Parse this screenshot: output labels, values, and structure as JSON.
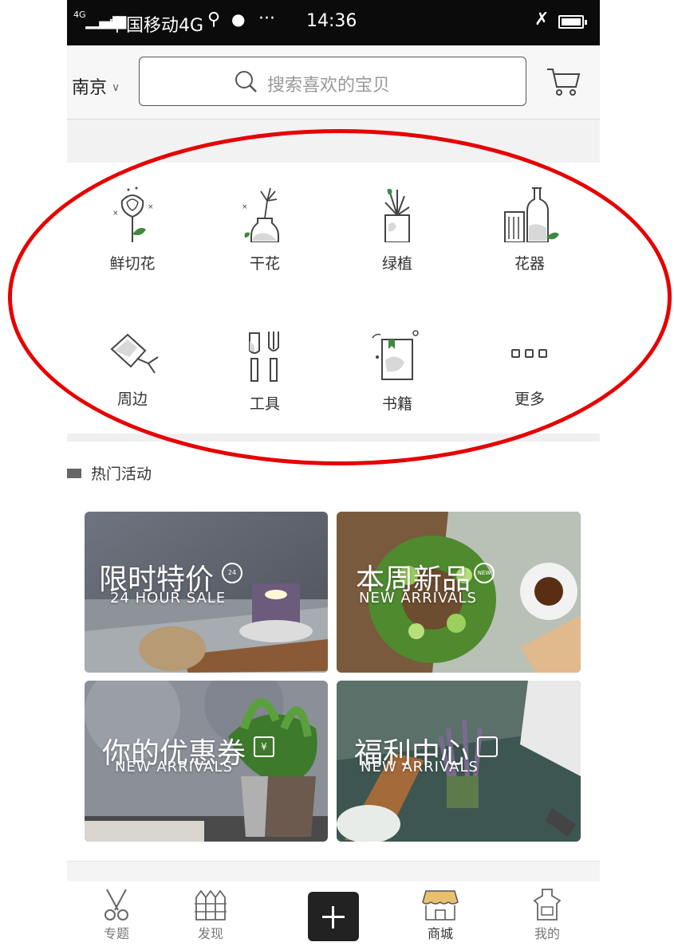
{
  "status_bar": {
    "network": "4G",
    "carrier": "中国移动4G",
    "more": "···",
    "time": "14:36"
  },
  "header": {
    "city": "南京",
    "search_placeholder": "搜索喜欢的宝贝"
  },
  "categories": [
    {
      "label": "鲜切花",
      "icon": "rose-icon"
    },
    {
      "label": "干花",
      "icon": "dried-flower-vase-icon"
    },
    {
      "label": "绿植",
      "icon": "potted-plant-icon"
    },
    {
      "label": "花器",
      "icon": "vases-icon"
    },
    {
      "label": "周边",
      "icon": "watering-can-icon"
    },
    {
      "label": "工具",
      "icon": "trowel-fork-icon"
    },
    {
      "label": "书籍",
      "icon": "book-icon"
    },
    {
      "label": "更多",
      "icon": "more-dots-icon"
    }
  ],
  "section": {
    "title": "热门活动"
  },
  "banners": [
    {
      "title": "限时特价",
      "subtitle": "24 HOUR SALE",
      "badge": "24"
    },
    {
      "title": "本周新品",
      "subtitle": "NEW ARRIVALS",
      "badge": "NEW"
    },
    {
      "title": "你的优惠券",
      "subtitle": "NEW ARRIVALS",
      "badge": "¥"
    },
    {
      "title": "福利中心",
      "subtitle": "NEW ARRIVALS",
      "badge": ""
    }
  ],
  "tabs": [
    {
      "label": "专题",
      "icon": "scissors-icon",
      "active": false
    },
    {
      "label": "发现",
      "icon": "fence-icon",
      "active": false
    },
    {
      "label": "",
      "icon": "plus-icon",
      "active": false
    },
    {
      "label": "商城",
      "icon": "shop-awning-icon",
      "active": true
    },
    {
      "label": "我的",
      "icon": "apron-icon",
      "active": false
    }
  ],
  "colors": {
    "annotation": "#e60000",
    "shop_tab_active": "#e8c070",
    "leaf_green": "#3d8a3d"
  }
}
